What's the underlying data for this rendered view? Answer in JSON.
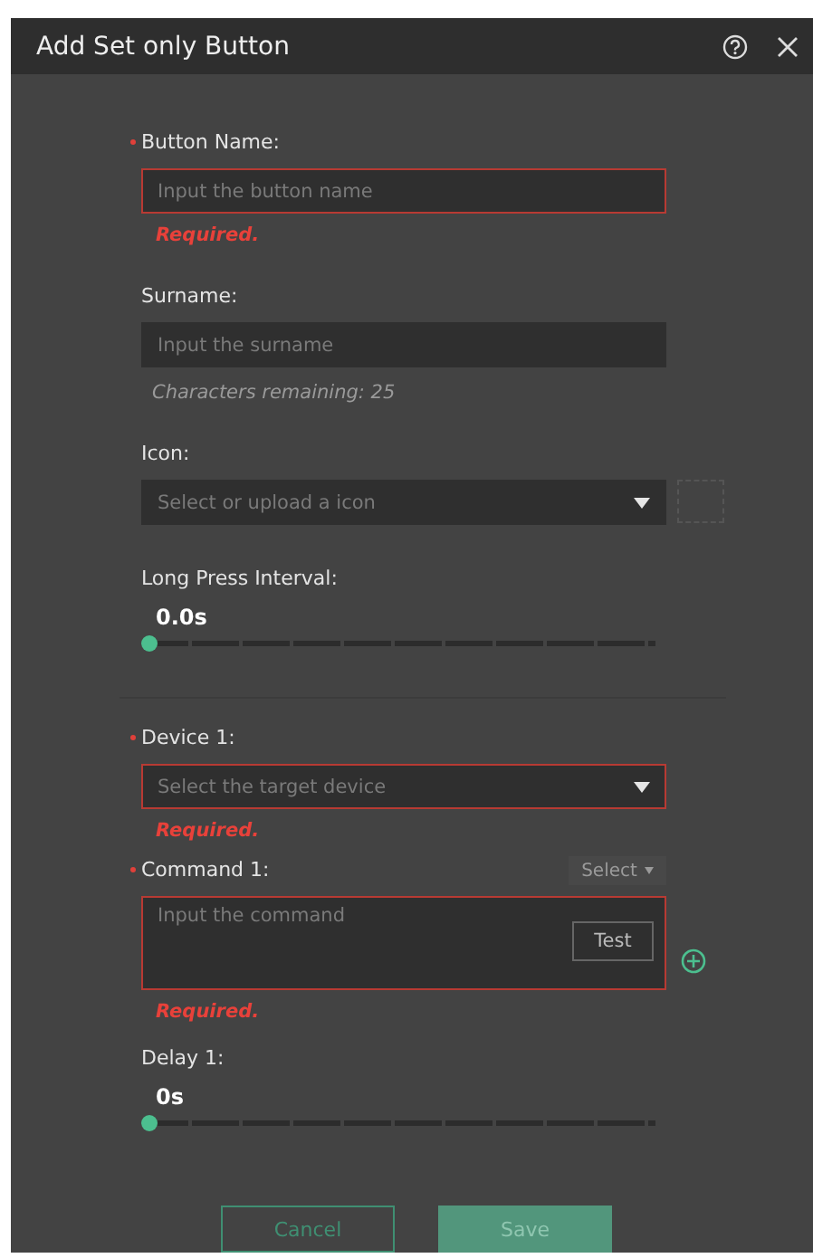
{
  "dialog": {
    "title": "Add Set only Button"
  },
  "fields": [
    {
      "kind": "input",
      "label": "Button Name:",
      "required": true,
      "placeholder": "Input the button name",
      "error": "Required.",
      "invalid": true
    },
    {
      "kind": "input",
      "label": "Surname:",
      "required": false,
      "placeholder": "Input the surname",
      "hint": "Characters remaining: 25",
      "invalid": false
    },
    {
      "kind": "iconselect",
      "label": "Icon:",
      "required": false,
      "placeholder": "Select or upload a icon",
      "invalid": false
    },
    {
      "kind": "slider",
      "label": "Long Press Interval:",
      "required": false,
      "reading": "0.0s",
      "level": 0
    },
    {
      "kind": "divider"
    },
    {
      "kind": "select",
      "label": "Device 1:",
      "required": true,
      "placeholder": "Select the target device",
      "error": "Required.",
      "invalid": true
    },
    {
      "kind": "command",
      "label": "Command 1:",
      "required": true,
      "placeholder": "Input the command",
      "selector": "Select",
      "test": "Test",
      "error": "Required.",
      "invalid": true
    },
    {
      "kind": "slider",
      "label": "Delay 1:",
      "required": false,
      "reading": "0s",
      "level": 0
    }
  ],
  "buttons": [
    {
      "label": "Cancel",
      "primary": false
    },
    {
      "label": "Save",
      "primary": true
    }
  ]
}
